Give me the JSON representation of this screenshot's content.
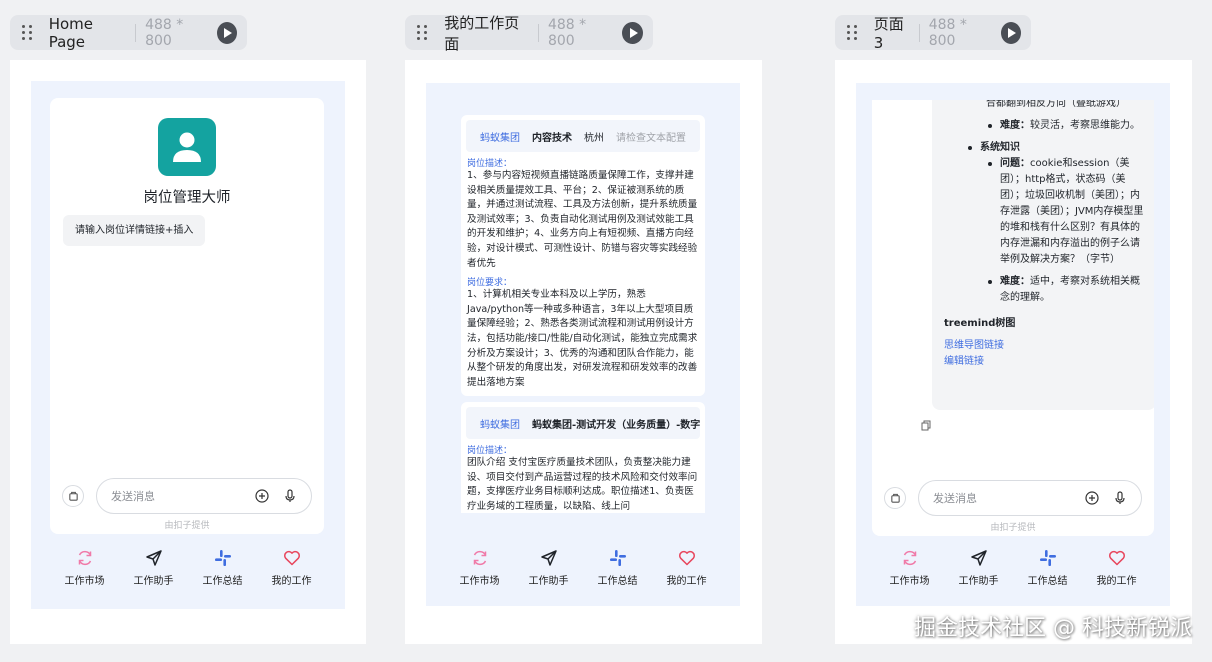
{
  "frames": [
    {
      "title": "Home Page",
      "size": "488 * 800"
    },
    {
      "title": "我的工作页面",
      "size": "488 * 800"
    },
    {
      "title": "页面3",
      "size": "488 * 800"
    }
  ],
  "home": {
    "bot_name": "岗位管理大师",
    "suggestion": "请输入岗位详情链接+插入"
  },
  "input": {
    "placeholder": "发送消息",
    "provided_by": "由扣子提供"
  },
  "tabs": [
    "工作市场",
    "工作助手",
    "工作总结",
    "我的工作"
  ],
  "colors": {
    "accent": "#3f6de0",
    "avatar": "#14a3a0",
    "heart": "#e8455c",
    "refresh": "#f07aa8"
  },
  "work": {
    "jobs": [
      {
        "company": "蚂蚁集团",
        "dept": "内容技术",
        "city": "杭州",
        "extra": "请检查文本配置",
        "desc_label": "岗位描述：",
        "desc": "1、参与内容短视频直播链路质量保障工作，支撑并建设相关质量提效工具、平台；2、保证被测系统的质量，并通过测试流程、工具及方法创新，提升系统质量及测试效率；3、负责自动化测试用例及测试效能工具的开发和维护；4、业务方向上有短视频、直播方向经验，对设计模式、可测性设计、防错与容灾等实践经验者优先",
        "req_label": "岗位要求：",
        "req": "1、计算机相关专业本科及以上学历，熟悉Java/python等一种或多种语言，3年以上大型项目质量保障经验；2、熟悉各类测试流程和测试用例设计方法，包括功能/接口/性能/自动化测试，能独立完成需求分析及方案设计；3、优秀的沟通和团队合作能力，能从整个研发的角度出发，对研发流程和研发效率的改善提出落地方案"
      },
      {
        "company": "蚂蚁集团",
        "dept": "蚂蚁集团-测试开发（业务质量）-数字",
        "desc_label": "岗位描述：",
        "desc": "团队介绍 支付宝医疗质量技术团队，负责整决能力建设、项目交付到产品运营过程的技术风险和交付效率问题，支撑医疗业务目标顺利达成。职位描述1、负责医疗业务域的工程质量，以缺陷、线上问"
      }
    ]
  },
  "page3": {
    "top_line": "合都翻到相反方向（叠纸游戏）",
    "difficulty1_label": "难度：",
    "difficulty1": "较灵活，考察思维能力。",
    "section": "系统知识",
    "q_label": "问题：",
    "question": "cookie和session（美团）；http格式，状态码（美团）；垃圾回收机制（美团）；内存泄露（美团）；JVM内存模型里的堆和栈有什么区别？有具体的内存泄漏和内存溢出的例子么请举例及解决方案？（字节）",
    "difficulty2_label": "难度：",
    "difficulty2": "适中，考察对系统相关概念的理解。",
    "tree_title": "treemind树图",
    "link1": "思维导图链接",
    "link2": "编辑链接"
  },
  "watermark": "掘金技术社区 @ 科技新锐派"
}
